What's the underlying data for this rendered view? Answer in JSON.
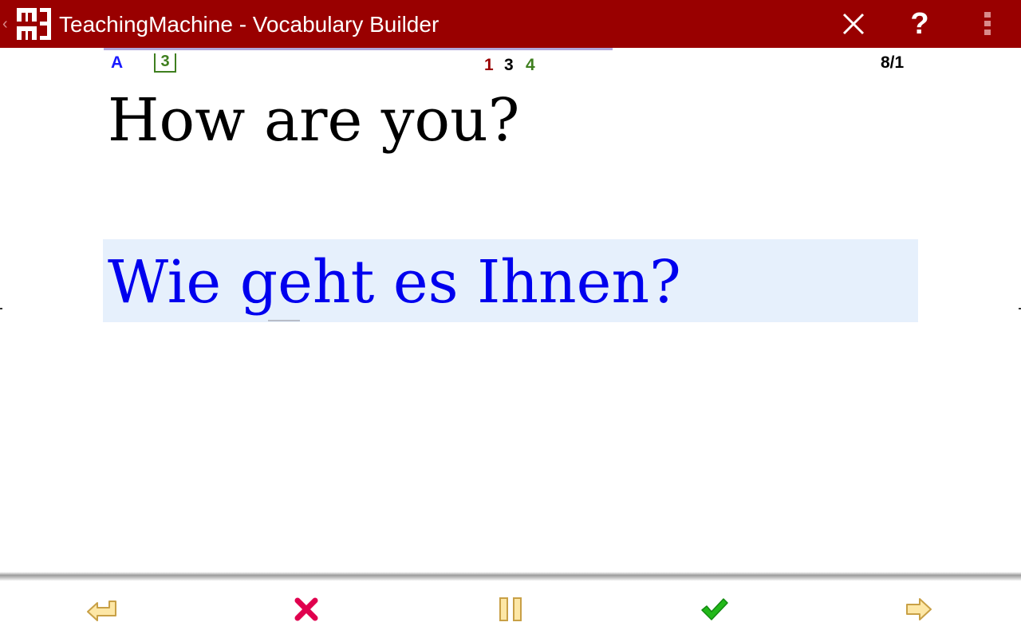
{
  "app": {
    "title": "TeachingMachine - Vocabulary Builder"
  },
  "actionbar": {
    "icons": [
      "app-logo-icon",
      "close-icon",
      "help-icon",
      "overflow-menu-icon"
    ]
  },
  "info": {
    "mode_letter": "A",
    "lesson_number": "3",
    "box_counts": [
      "1",
      "3",
      "4"
    ],
    "position": "8/1"
  },
  "card": {
    "question": "How are you?",
    "answer": "Wie geht es Ihnen?"
  },
  "colors": {
    "actionbar_bg": "#990000",
    "answer_text": "#0000ee",
    "answer_bg": "#e6f0fc",
    "mode_letter": "#1a1aff",
    "count_red": "#990000",
    "count_black": "#000000",
    "count_green": "#3f7f1f",
    "check_green": "#22b81a",
    "wrong_red": "#e0004e",
    "arrow_gold": "#c8a046"
  },
  "bottombar": {
    "buttons": [
      "back-icon",
      "wrong-icon",
      "pause-icon",
      "correct-icon",
      "next-icon"
    ]
  }
}
